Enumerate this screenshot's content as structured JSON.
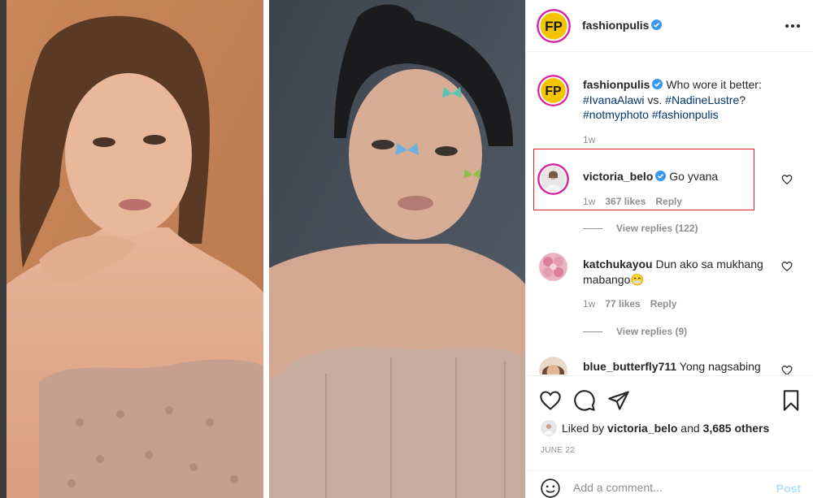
{
  "post": {
    "username": "fashionpulis",
    "verified": true,
    "logo_text": "FP"
  },
  "comments": [
    {
      "username": "fashionpulis",
      "text_before": "Who wore it better: ",
      "tag1": "#IvanaAlawi",
      "mid": " vs. ",
      "tag2": "#NadineLustre",
      "after": "?",
      "tag3": "#notmyphoto",
      "tag4": "#fashionpulis",
      "time": "1w"
    },
    {
      "username": "victoria_belo",
      "text": "Go yvana",
      "time": "1w",
      "likes": "367 likes",
      "reply": "Reply",
      "view_replies": "View replies (122)"
    },
    {
      "username": "katchukayou",
      "text": "Dun ako sa mukhang mabango",
      "emoji": "😁",
      "time": "1w",
      "likes": "77 likes",
      "reply": "Reply",
      "view_replies": "View replies (9)"
    },
    {
      "username": "blue_butterfly711",
      "text": "Yong nagsabing"
    }
  ],
  "liked_by": {
    "prefix": "Liked by ",
    "user": "victoria_belo",
    "middle": " and ",
    "others": "3,685 others"
  },
  "date": "JUNE 22",
  "add_comment": {
    "placeholder": "Add a comment...",
    "post_label": "Post"
  },
  "colors": {
    "link": "#00376b",
    "muted": "#8e8e8e",
    "verified": "#3897f0",
    "highlight": "#e0242b",
    "post_disabled": "#b2dffc"
  }
}
